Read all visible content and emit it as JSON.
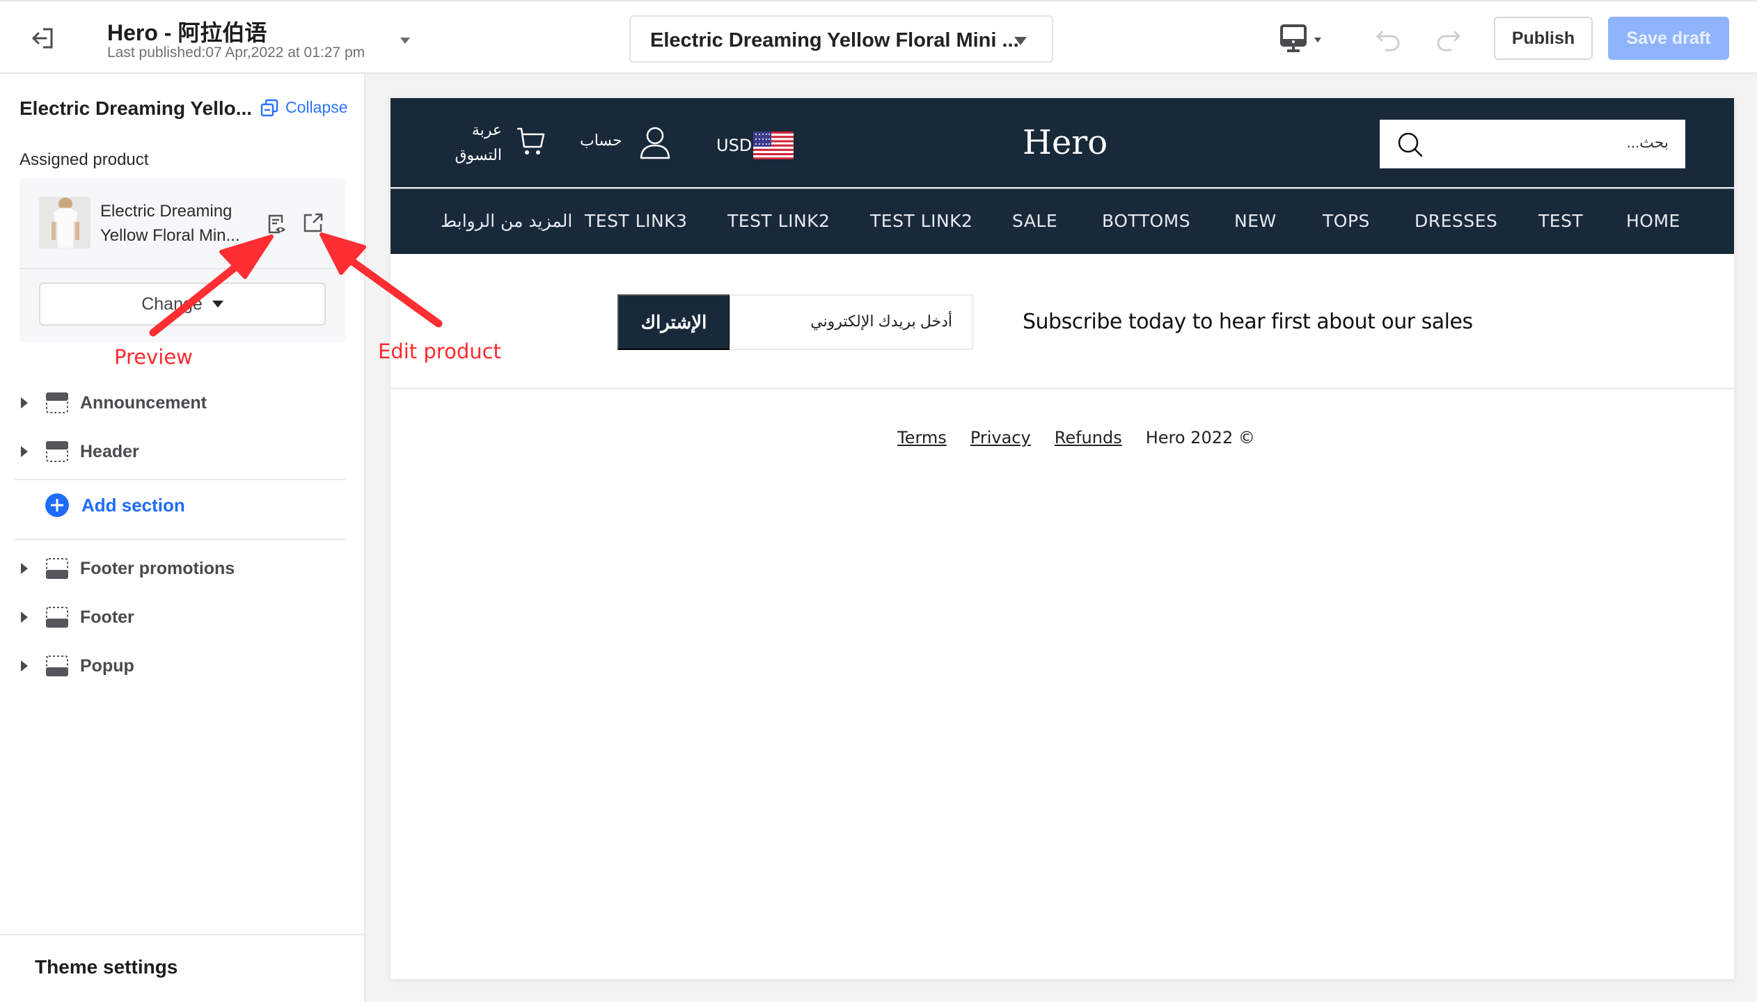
{
  "topbar": {
    "site_title": "Hero - 阿拉伯语",
    "last_published": "Last published:07 Apr,2022 at 01:27 pm",
    "page_select_value": "Electric Dreaming Yellow Floral Mini ...",
    "publish_label": "Publish",
    "save_draft_label": "Save draft",
    "icons": [
      "exit-icon",
      "caret-down-icon",
      "desktop-icon",
      "undo-icon",
      "redo-icon"
    ]
  },
  "sidebar": {
    "title": "Electric Dreaming Yello...",
    "collapse_label": "Collapse",
    "assigned_product_label": "Assigned product",
    "product": {
      "name": "Electric Dreaming Yellow Floral Min..."
    },
    "change_label": "Change",
    "sections_top": [
      {
        "label": "Announcement",
        "icon": "section-top-icon"
      },
      {
        "label": "Header",
        "icon": "section-top-icon"
      }
    ],
    "add_section_label": "Add section",
    "sections_bottom": [
      {
        "label": "Footer promotions",
        "icon": "section-bottom-icon"
      },
      {
        "label": "Footer",
        "icon": "section-bottom-icon"
      },
      {
        "label": "Popup",
        "icon": "section-bottom-icon"
      }
    ],
    "theme_settings_label": "Theme settings"
  },
  "store": {
    "cart_label": "عربة التسوق",
    "account_label": "حساب",
    "currency": "USD",
    "logo": "Hero",
    "search_placeholder": "بحث...",
    "nav": [
      "المزيد من الروابط",
      "TEST LINK3",
      "TEST LINK2",
      "TEST LINK2",
      "SALE",
      "BOTTOMS",
      "NEW",
      "TOPS",
      "DRESSES",
      "TEST",
      "HOME"
    ],
    "newsletter": {
      "button_label": "الإشتراك",
      "input_placeholder": "أدخل بريدك الإلكتروني",
      "text": "Subscribe today to hear first about our sales"
    },
    "footer": {
      "links": [
        "Terms",
        "Privacy",
        "Refunds"
      ],
      "copyright": "Hero 2022 ©"
    }
  },
  "annotations": {
    "preview": "Preview",
    "edit_product": "Edit product",
    "color": "#ff2a2e"
  },
  "colors": {
    "accent": "#1f6bff",
    "store_dark": "#18293a",
    "save_draft_bg": "#90b4fb"
  }
}
